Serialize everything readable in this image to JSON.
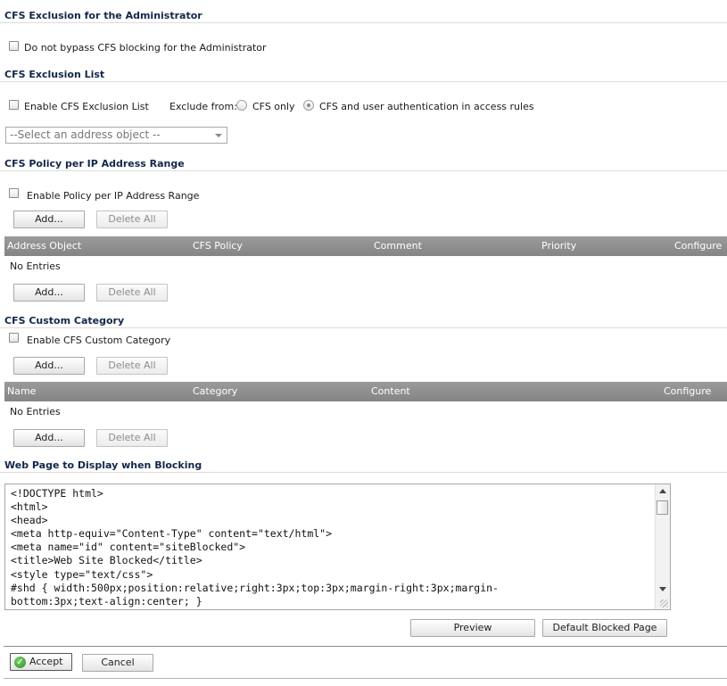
{
  "admin_exclusion": {
    "title": "CFS Exclusion for the Administrator",
    "checkbox_label": "Do not bypass CFS blocking for the Administrator"
  },
  "exclusion_list": {
    "title": "CFS Exclusion List",
    "checkbox_label": "Enable CFS Exclusion List",
    "exclude_from_label": "Exclude from:",
    "radio_cfs_only": "CFS only",
    "radio_cfs_auth": "CFS and user authentication in access rules",
    "select_placeholder": "--Select an address object --"
  },
  "ip_range": {
    "title": "CFS Policy per IP Address Range",
    "checkbox_label": "Enable Policy per IP Address Range",
    "add_label": "Add...",
    "delete_all_label": "Delete All",
    "columns": [
      "Address Object",
      "CFS Policy",
      "Comment",
      "Priority",
      "Configure"
    ],
    "empty_text": "No Entries"
  },
  "custom_category": {
    "title": "CFS Custom Category",
    "checkbox_label": "Enable CFS Custom Category",
    "add_label": "Add...",
    "delete_all_label": "Delete All",
    "columns": [
      "Name",
      "Category",
      "Content",
      "Configure"
    ],
    "empty_text": "No Entries"
  },
  "block_page": {
    "title": "Web Page to Display when Blocking",
    "content": "<!DOCTYPE html>\n<html>\n<head>\n<meta http-equiv=\"Content-Type\" content=\"text/html\">\n<meta name=\"id\" content=\"siteBlocked\">\n<title>Web Site Blocked</title>\n<style type=\"text/css\">\n#shd { width:500px;position:relative;right:3px;top:3px;margin-right:3px;margin-\nbottom:3px;text-align:center; }",
    "preview_label": "Preview",
    "default_label": "Default Blocked Page"
  },
  "footer": {
    "accept_label": "Accept",
    "cancel_label": "Cancel"
  },
  "icons": {
    "accept": "check-circle-icon"
  }
}
